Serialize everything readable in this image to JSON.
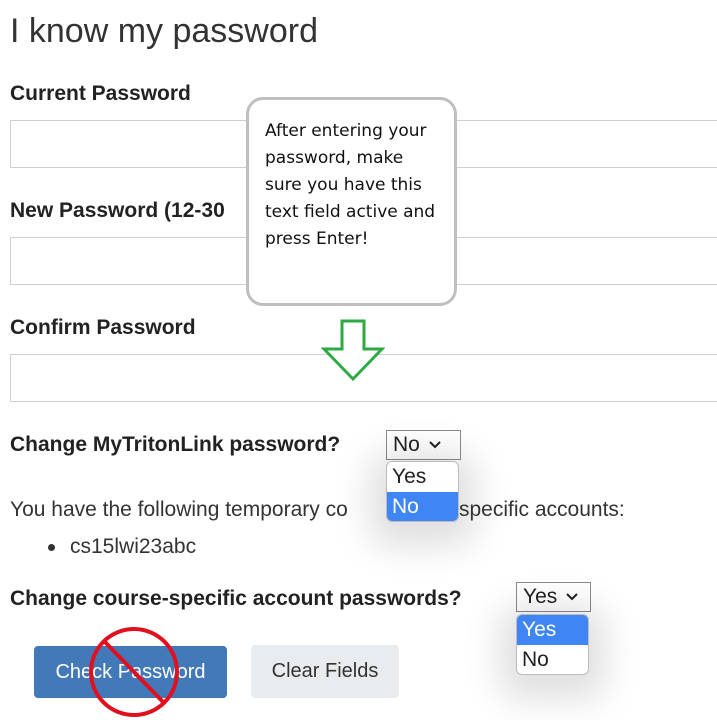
{
  "page": {
    "title": "I know my password"
  },
  "form": {
    "current_password_label": "Current Password",
    "new_password_label": "New Password (12-30",
    "confirm_password_label": "Confirm Password",
    "mytritonlink_question": "Change MyTritonLink password?",
    "mytritonlink_selected": "No",
    "mytritonlink_options": [
      "Yes",
      "No"
    ],
    "accounts_intro": "You have the following temporary course-specific accounts:",
    "accounts_intro_visible_left": "You have the following temporary co",
    "accounts_intro_visible_right": "specific accounts:",
    "accounts": [
      "cs15lwi23abc"
    ],
    "course_question": "Change course-specific account passwords?",
    "course_selected": "Yes",
    "course_options": [
      "Yes",
      "No"
    ]
  },
  "buttons": {
    "check_password": "Check Password",
    "clear_fields": "Clear Fields"
  },
  "annotations": {
    "callout_text": "After entering your password, make sure you have this text field active and press Enter!",
    "arrow_color": "#2eaa45",
    "no_sign_color": "#e0101e"
  },
  "colors": {
    "primary_button": "#4279b8",
    "secondary_button": "#e9ecef",
    "option_highlight": "#3f86f4"
  }
}
